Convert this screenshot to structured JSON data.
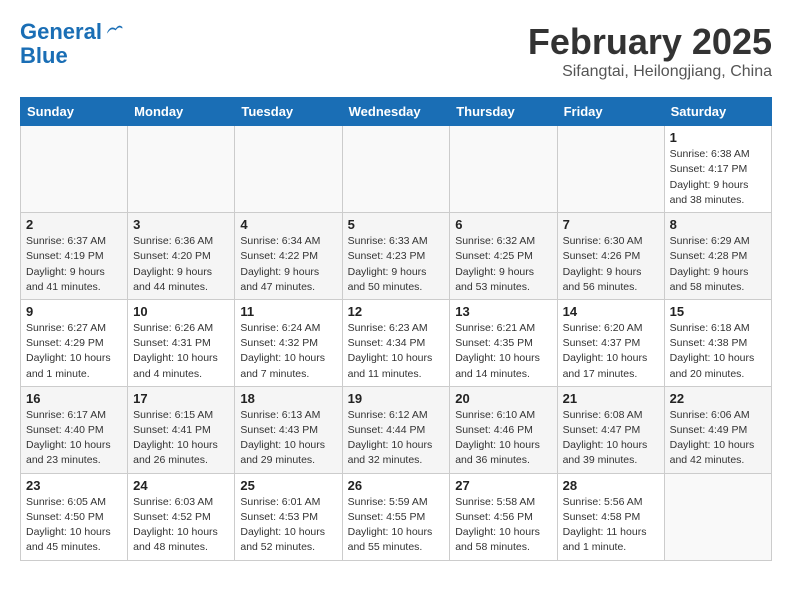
{
  "logo": {
    "line1": "General",
    "line2": "Blue"
  },
  "title": "February 2025",
  "subtitle": "Sifangtai, Heilongjiang, China",
  "weekdays": [
    "Sunday",
    "Monday",
    "Tuesday",
    "Wednesday",
    "Thursday",
    "Friday",
    "Saturday"
  ],
  "weeks": [
    [
      {
        "day": "",
        "info": ""
      },
      {
        "day": "",
        "info": ""
      },
      {
        "day": "",
        "info": ""
      },
      {
        "day": "",
        "info": ""
      },
      {
        "day": "",
        "info": ""
      },
      {
        "day": "",
        "info": ""
      },
      {
        "day": "1",
        "info": "Sunrise: 6:38 AM\nSunset: 4:17 PM\nDaylight: 9 hours and 38 minutes."
      }
    ],
    [
      {
        "day": "2",
        "info": "Sunrise: 6:37 AM\nSunset: 4:19 PM\nDaylight: 9 hours and 41 minutes."
      },
      {
        "day": "3",
        "info": "Sunrise: 6:36 AM\nSunset: 4:20 PM\nDaylight: 9 hours and 44 minutes."
      },
      {
        "day": "4",
        "info": "Sunrise: 6:34 AM\nSunset: 4:22 PM\nDaylight: 9 hours and 47 minutes."
      },
      {
        "day": "5",
        "info": "Sunrise: 6:33 AM\nSunset: 4:23 PM\nDaylight: 9 hours and 50 minutes."
      },
      {
        "day": "6",
        "info": "Sunrise: 6:32 AM\nSunset: 4:25 PM\nDaylight: 9 hours and 53 minutes."
      },
      {
        "day": "7",
        "info": "Sunrise: 6:30 AM\nSunset: 4:26 PM\nDaylight: 9 hours and 56 minutes."
      },
      {
        "day": "8",
        "info": "Sunrise: 6:29 AM\nSunset: 4:28 PM\nDaylight: 9 hours and 58 minutes."
      }
    ],
    [
      {
        "day": "9",
        "info": "Sunrise: 6:27 AM\nSunset: 4:29 PM\nDaylight: 10 hours and 1 minute."
      },
      {
        "day": "10",
        "info": "Sunrise: 6:26 AM\nSunset: 4:31 PM\nDaylight: 10 hours and 4 minutes."
      },
      {
        "day": "11",
        "info": "Sunrise: 6:24 AM\nSunset: 4:32 PM\nDaylight: 10 hours and 7 minutes."
      },
      {
        "day": "12",
        "info": "Sunrise: 6:23 AM\nSunset: 4:34 PM\nDaylight: 10 hours and 11 minutes."
      },
      {
        "day": "13",
        "info": "Sunrise: 6:21 AM\nSunset: 4:35 PM\nDaylight: 10 hours and 14 minutes."
      },
      {
        "day": "14",
        "info": "Sunrise: 6:20 AM\nSunset: 4:37 PM\nDaylight: 10 hours and 17 minutes."
      },
      {
        "day": "15",
        "info": "Sunrise: 6:18 AM\nSunset: 4:38 PM\nDaylight: 10 hours and 20 minutes."
      }
    ],
    [
      {
        "day": "16",
        "info": "Sunrise: 6:17 AM\nSunset: 4:40 PM\nDaylight: 10 hours and 23 minutes."
      },
      {
        "day": "17",
        "info": "Sunrise: 6:15 AM\nSunset: 4:41 PM\nDaylight: 10 hours and 26 minutes."
      },
      {
        "day": "18",
        "info": "Sunrise: 6:13 AM\nSunset: 4:43 PM\nDaylight: 10 hours and 29 minutes."
      },
      {
        "day": "19",
        "info": "Sunrise: 6:12 AM\nSunset: 4:44 PM\nDaylight: 10 hours and 32 minutes."
      },
      {
        "day": "20",
        "info": "Sunrise: 6:10 AM\nSunset: 4:46 PM\nDaylight: 10 hours and 36 minutes."
      },
      {
        "day": "21",
        "info": "Sunrise: 6:08 AM\nSunset: 4:47 PM\nDaylight: 10 hours and 39 minutes."
      },
      {
        "day": "22",
        "info": "Sunrise: 6:06 AM\nSunset: 4:49 PM\nDaylight: 10 hours and 42 minutes."
      }
    ],
    [
      {
        "day": "23",
        "info": "Sunrise: 6:05 AM\nSunset: 4:50 PM\nDaylight: 10 hours and 45 minutes."
      },
      {
        "day": "24",
        "info": "Sunrise: 6:03 AM\nSunset: 4:52 PM\nDaylight: 10 hours and 48 minutes."
      },
      {
        "day": "25",
        "info": "Sunrise: 6:01 AM\nSunset: 4:53 PM\nDaylight: 10 hours and 52 minutes."
      },
      {
        "day": "26",
        "info": "Sunrise: 5:59 AM\nSunset: 4:55 PM\nDaylight: 10 hours and 55 minutes."
      },
      {
        "day": "27",
        "info": "Sunrise: 5:58 AM\nSunset: 4:56 PM\nDaylight: 10 hours and 58 minutes."
      },
      {
        "day": "28",
        "info": "Sunrise: 5:56 AM\nSunset: 4:58 PM\nDaylight: 11 hours and 1 minute."
      },
      {
        "day": "",
        "info": ""
      }
    ]
  ]
}
